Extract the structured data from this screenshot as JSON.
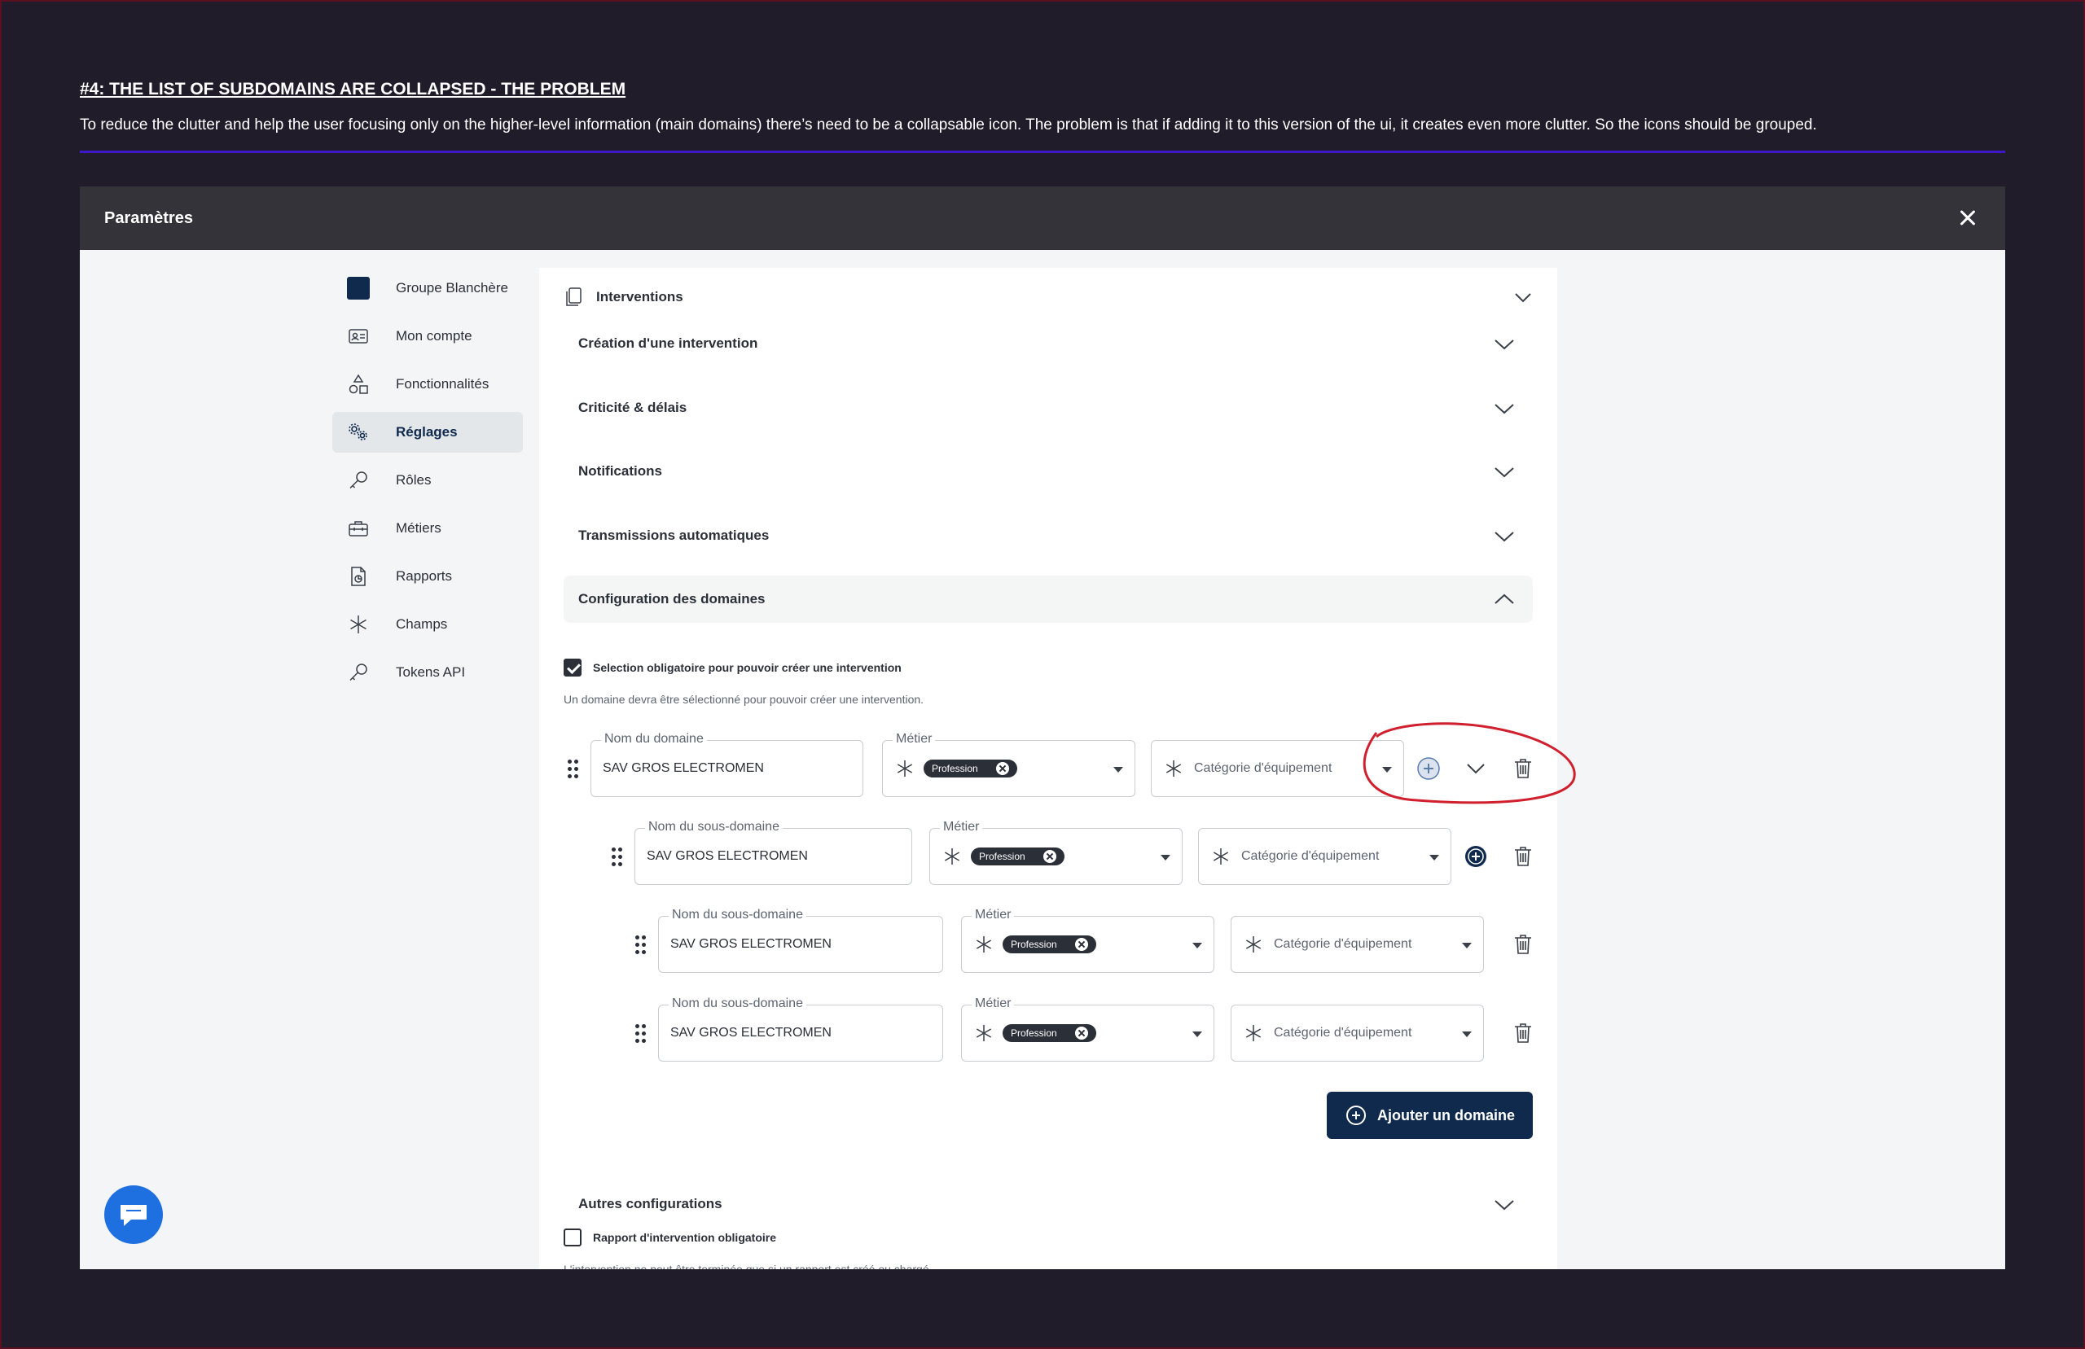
{
  "note": {
    "title": "#4: THE LIST OF SUBDOMAINS ARE COLLAPSED - THE PROBLEM",
    "body": "To reduce the clutter and help the user focusing only on the higher-level information (main domains) there’s need to be a collapsable icon. The problem is that if adding it to this version of the ui, it creates even more clutter. So the icons should be grouped."
  },
  "modal": {
    "title": "Paramètres"
  },
  "sidebar": {
    "items": [
      {
        "label": "Groupe Blanchère",
        "icon": "brand-square-icon"
      },
      {
        "label": "Mon compte",
        "icon": "id-card-icon"
      },
      {
        "label": "Fonctionnalités",
        "icon": "shapes-icon"
      },
      {
        "label": "Réglages",
        "icon": "gears-icon",
        "active": true
      },
      {
        "label": "Rôles",
        "icon": "key-icon"
      },
      {
        "label": "Métiers",
        "icon": "toolbox-icon"
      },
      {
        "label": "Rapports",
        "icon": "report-icon"
      },
      {
        "label": "Champs",
        "icon": "asterisk-icon"
      },
      {
        "label": "Tokens API",
        "icon": "key-icon"
      }
    ]
  },
  "panel": {
    "header": "Interventions",
    "sections": [
      "Création d'une intervention",
      "Criticité & délais",
      "Notifications",
      "Transmissions automatiques",
      "Configuration des domaines"
    ],
    "mandatory_checkbox": "Selection obligatoire pour pouvoir créer une intervention",
    "mandatory_help": "Un domaine devra être sélectionné pour pouvoir créer une intervention.",
    "domain": {
      "name_label": "Nom du domaine",
      "name_value": "SAV GROS ELECTROMEN",
      "metier_label": "Métier",
      "chip": "Profession",
      "category_placeholder": "Catégorie d'équipement"
    },
    "subdomains": [
      {
        "name_label": "Nom du sous-domaine",
        "name_value": "SAV GROS ELECTROMEN",
        "metier_label": "Métier",
        "chip": "Profession",
        "category_placeholder": "Catégorie d'équipement"
      },
      {
        "name_label": "Nom du sous-domaine",
        "name_value": "SAV GROS ELECTROMEN",
        "metier_label": "Métier",
        "chip": "Profession",
        "category_placeholder": "Catégorie d'équipement"
      },
      {
        "name_label": "Nom du sous-domaine",
        "name_value": "SAV GROS ELECTROMEN",
        "metier_label": "Métier",
        "chip": "Profession",
        "category_placeholder": "Catégorie d'équipement"
      }
    ],
    "add_domain": "Ajouter un domaine",
    "other_section": "Autres configurations",
    "report_checkbox": "Rapport d'intervention obligatoire",
    "report_help": "L'intervention ne peut être terminée que si un rapport est créé ou chargé."
  },
  "colors": {
    "background": "#201c2a",
    "accent": "#0f2a4d",
    "annotation": "#d0202e",
    "rule": "#3d17c9",
    "chat": "#1e6fe0"
  }
}
